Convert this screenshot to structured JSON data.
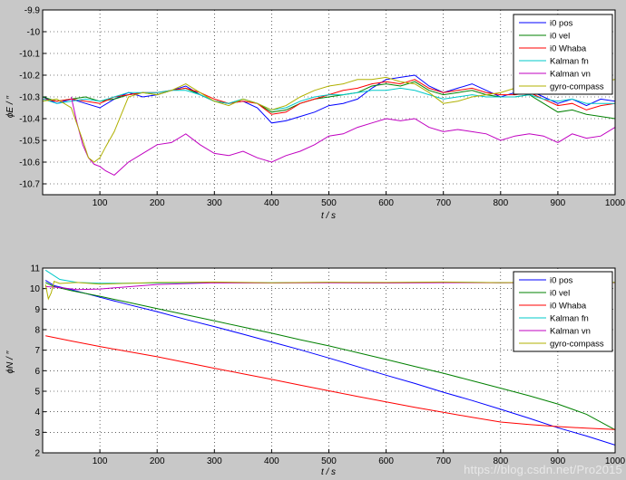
{
  "figure": {
    "background": "#c8c8c8",
    "axes_background": "#ffffff",
    "watermark": "https://blog.csdn.net/Pro2015"
  },
  "chart_data": [
    {
      "type": "line",
      "title": "",
      "xlabel": "t  / s",
      "ylabel": "ϕE / ′′",
      "ylabel_sub": "E",
      "xlim": [
        0,
        1000
      ],
      "ylim": [
        -10.75,
        -9.9
      ],
      "xticks": [
        100,
        200,
        300,
        400,
        500,
        600,
        700,
        800,
        900,
        1000
      ],
      "yticks": [
        -10.7,
        -10.6,
        -10.5,
        -10.4,
        -10.3,
        -10.2,
        -10.1,
        -10,
        -9.9
      ],
      "grid": true,
      "legend_position": "top-right",
      "series": [
        {
          "name": "i0 pos",
          "color": "#0000ff",
          "x": [
            0,
            25,
            50,
            75,
            100,
            125,
            150,
            175,
            200,
            225,
            250,
            275,
            300,
            325,
            350,
            375,
            400,
            425,
            450,
            475,
            500,
            525,
            550,
            575,
            600,
            625,
            650,
            675,
            700,
            725,
            750,
            775,
            800,
            825,
            850,
            875,
            900,
            925,
            950,
            975,
            1000
          ],
          "y": [
            -10.3,
            -10.33,
            -10.31,
            -10.33,
            -10.35,
            -10.31,
            -10.28,
            -10.3,
            -10.29,
            -10.27,
            -10.25,
            -10.29,
            -10.32,
            -10.33,
            -10.32,
            -10.35,
            -10.42,
            -10.41,
            -10.39,
            -10.37,
            -10.34,
            -10.33,
            -10.31,
            -10.26,
            -10.22,
            -10.21,
            -10.2,
            -10.25,
            -10.28,
            -10.26,
            -10.24,
            -10.27,
            -10.3,
            -10.28,
            -10.27,
            -10.3,
            -10.33,
            -10.31,
            -10.34,
            -10.31,
            -10.32
          ]
        },
        {
          "name": "i0 vel",
          "color": "#008000",
          "x": [
            0,
            25,
            50,
            75,
            100,
            125,
            150,
            175,
            200,
            225,
            250,
            275,
            300,
            325,
            350,
            375,
            400,
            425,
            450,
            475,
            500,
            525,
            550,
            575,
            600,
            625,
            650,
            675,
            700,
            725,
            750,
            775,
            800,
            825,
            850,
            875,
            900,
            925,
            950,
            975,
            1000
          ],
          "y": [
            -10.3,
            -10.32,
            -10.31,
            -10.3,
            -10.32,
            -10.31,
            -10.29,
            -10.28,
            -10.29,
            -10.27,
            -10.26,
            -10.29,
            -10.32,
            -10.33,
            -10.31,
            -10.33,
            -10.37,
            -10.36,
            -10.33,
            -10.31,
            -10.3,
            -10.29,
            -10.28,
            -10.25,
            -10.24,
            -10.25,
            -10.23,
            -10.27,
            -10.29,
            -10.28,
            -10.27,
            -10.29,
            -10.3,
            -10.3,
            -10.29,
            -10.33,
            -10.37,
            -10.36,
            -10.38,
            -10.39,
            -10.4
          ]
        },
        {
          "name": "i0 Whaba",
          "color": "#ff0000",
          "x": [
            0,
            25,
            50,
            75,
            100,
            125,
            150,
            175,
            200,
            225,
            250,
            275,
            300,
            325,
            350,
            375,
            400,
            425,
            450,
            475,
            500,
            525,
            550,
            575,
            600,
            625,
            650,
            675,
            700,
            725,
            750,
            775,
            800,
            825,
            850,
            875,
            900,
            925,
            950,
            975,
            1000
          ],
          "y": [
            -10.31,
            -10.32,
            -10.31,
            -10.32,
            -10.33,
            -10.3,
            -10.29,
            -10.28,
            -10.28,
            -10.27,
            -10.26,
            -10.28,
            -10.31,
            -10.33,
            -10.32,
            -10.33,
            -10.38,
            -10.37,
            -10.33,
            -10.31,
            -10.29,
            -10.27,
            -10.26,
            -10.24,
            -10.23,
            -10.24,
            -10.22,
            -10.26,
            -10.28,
            -10.27,
            -10.26,
            -10.28,
            -10.29,
            -10.29,
            -10.28,
            -10.31,
            -10.34,
            -10.33,
            -10.36,
            -10.34,
            -10.33
          ]
        },
        {
          "name": "Kalman fn",
          "color": "#00c8c8",
          "x": [
            0,
            25,
            50,
            75,
            100,
            125,
            150,
            175,
            200,
            225,
            250,
            275,
            300,
            325,
            350,
            375,
            400,
            425,
            450,
            475,
            500,
            525,
            550,
            575,
            600,
            625,
            650,
            675,
            700,
            725,
            750,
            775,
            800,
            825,
            850,
            875,
            900,
            925,
            950,
            975,
            1000
          ],
          "y": [
            -10.31,
            -10.33,
            -10.32,
            -10.31,
            -10.32,
            -10.3,
            -10.28,
            -10.28,
            -10.28,
            -10.27,
            -10.27,
            -10.29,
            -10.32,
            -10.33,
            -10.31,
            -10.33,
            -10.36,
            -10.35,
            -10.32,
            -10.3,
            -10.29,
            -10.29,
            -10.28,
            -10.27,
            -10.27,
            -10.26,
            -10.27,
            -10.29,
            -10.31,
            -10.3,
            -10.29,
            -10.3,
            -10.3,
            -10.3,
            -10.29,
            -10.31,
            -10.32,
            -10.31,
            -10.33,
            -10.33,
            -10.33
          ]
        },
        {
          "name": "Kalman vn",
          "color": "#c000c0",
          "x": [
            50,
            60,
            70,
            80,
            90,
            100,
            110,
            125,
            150,
            175,
            200,
            225,
            250,
            275,
            300,
            325,
            350,
            375,
            400,
            425,
            450,
            475,
            500,
            525,
            550,
            575,
            600,
            625,
            650,
            675,
            700,
            725,
            750,
            775,
            800,
            825,
            850,
            875,
            900,
            925,
            950,
            975,
            1000
          ],
          "y": [
            -10.3,
            -10.42,
            -10.52,
            -10.58,
            -10.61,
            -10.62,
            -10.64,
            -10.66,
            -10.6,
            -10.56,
            -10.52,
            -10.51,
            -10.47,
            -10.52,
            -10.56,
            -10.57,
            -10.55,
            -10.58,
            -10.6,
            -10.57,
            -10.55,
            -10.52,
            -10.48,
            -10.47,
            -10.44,
            -10.42,
            -10.4,
            -10.41,
            -10.4,
            -10.44,
            -10.46,
            -10.45,
            -10.46,
            -10.47,
            -10.5,
            -10.48,
            -10.47,
            -10.48,
            -10.51,
            -10.47,
            -10.49,
            -10.48,
            -10.44
          ]
        },
        {
          "name": "gyro-compass",
          "color": "#b0b000",
          "x": [
            0,
            25,
            50,
            70,
            80,
            90,
            100,
            110,
            125,
            150,
            175,
            200,
            225,
            250,
            275,
            300,
            325,
            350,
            375,
            400,
            425,
            450,
            475,
            500,
            525,
            550,
            575,
            600,
            625,
            650,
            675,
            700,
            725,
            750,
            775,
            800,
            825,
            850,
            875,
            900,
            925,
            950,
            975,
            1000
          ],
          "y": [
            -10.32,
            -10.31,
            -10.35,
            -10.5,
            -10.58,
            -10.6,
            -10.58,
            -10.53,
            -10.46,
            -10.3,
            -10.28,
            -10.29,
            -10.27,
            -10.24,
            -10.28,
            -10.32,
            -10.34,
            -10.31,
            -10.33,
            -10.36,
            -10.34,
            -10.3,
            -10.27,
            -10.25,
            -10.24,
            -10.22,
            -10.22,
            -10.21,
            -10.23,
            -10.24,
            -10.28,
            -10.33,
            -10.32,
            -10.3,
            -10.29,
            -10.28,
            -10.26,
            -10.23,
            -10.22,
            -10.25,
            -10.22,
            -10.24,
            -10.23,
            -10.22
          ]
        }
      ]
    },
    {
      "type": "line",
      "title": "",
      "xlabel": "t  / s",
      "ylabel": "ϕN / ′′",
      "ylabel_sub": "N",
      "xlim": [
        0,
        1000
      ],
      "ylim": [
        2,
        11
      ],
      "xticks": [
        100,
        200,
        300,
        400,
        500,
        600,
        700,
        800,
        900,
        1000
      ],
      "yticks": [
        2,
        3,
        4,
        5,
        6,
        7,
        8,
        9,
        10,
        11
      ],
      "grid": true,
      "legend_position": "top-right",
      "series": [
        {
          "name": "i0 pos",
          "color": "#0000ff",
          "x": [
            5,
            20,
            50,
            100,
            150,
            200,
            250,
            300,
            350,
            400,
            450,
            500,
            550,
            600,
            650,
            700,
            750,
            800,
            850,
            900,
            950,
            1000
          ],
          "y": [
            10.4,
            10.15,
            9.95,
            9.58,
            9.22,
            8.88,
            8.5,
            8.15,
            7.78,
            7.4,
            7.02,
            6.62,
            6.2,
            5.78,
            5.38,
            4.95,
            4.55,
            4.12,
            3.68,
            3.22,
            2.82,
            2.38
          ]
        },
        {
          "name": "i0 vel",
          "color": "#008000",
          "x": [
            5,
            20,
            50,
            100,
            150,
            200,
            250,
            300,
            350,
            400,
            450,
            500,
            550,
            600,
            650,
            700,
            750,
            800,
            850,
            900,
            950,
            1000
          ],
          "y": [
            10.3,
            10.1,
            9.9,
            9.63,
            9.33,
            9.03,
            8.73,
            8.43,
            8.13,
            7.83,
            7.51,
            7.21,
            6.88,
            6.55,
            6.21,
            5.88,
            5.51,
            5.15,
            4.78,
            4.38,
            3.88,
            3.12
          ]
        },
        {
          "name": "i0 Whaba",
          "color": "#ff0000",
          "x": [
            5,
            50,
            100,
            150,
            200,
            250,
            300,
            350,
            400,
            450,
            500,
            550,
            600,
            650,
            700,
            750,
            800,
            850,
            900,
            950,
            1000
          ],
          "y": [
            7.7,
            7.45,
            7.18,
            6.93,
            6.68,
            6.4,
            6.12,
            5.85,
            5.58,
            5.3,
            5.02,
            4.75,
            4.48,
            4.22,
            3.97,
            3.73,
            3.5,
            3.38,
            3.28,
            3.2,
            3.14
          ]
        },
        {
          "name": "Kalman fn",
          "color": "#00c8c8",
          "x": [
            5,
            30,
            60,
            100,
            200,
            300,
            400,
            500,
            600,
            700,
            800,
            900,
            1000
          ],
          "y": [
            10.9,
            10.45,
            10.3,
            10.26,
            10.27,
            10.3,
            10.28,
            10.3,
            10.29,
            10.31,
            10.29,
            10.3,
            10.3
          ]
        },
        {
          "name": "Kalman vn",
          "color": "#c000c0",
          "x": [
            5,
            30,
            60,
            100,
            200,
            300,
            400,
            500,
            600,
            700,
            800,
            900,
            1000
          ],
          "y": [
            10.1,
            10.05,
            9.95,
            9.98,
            10.2,
            10.28,
            10.27,
            10.28,
            10.27,
            10.29,
            10.28,
            10.29,
            10.29
          ]
        },
        {
          "name": "gyro-compass",
          "color": "#b0b000",
          "x": [
            5,
            10,
            15,
            20,
            30,
            60,
            100,
            200,
            300,
            400,
            500,
            600,
            700,
            800,
            900,
            1000
          ],
          "y": [
            10.2,
            9.5,
            9.8,
            10.35,
            10.25,
            10.3,
            10.22,
            10.3,
            10.32,
            10.28,
            10.31,
            10.3,
            10.32,
            10.29,
            10.33,
            10.3
          ]
        }
      ]
    }
  ]
}
